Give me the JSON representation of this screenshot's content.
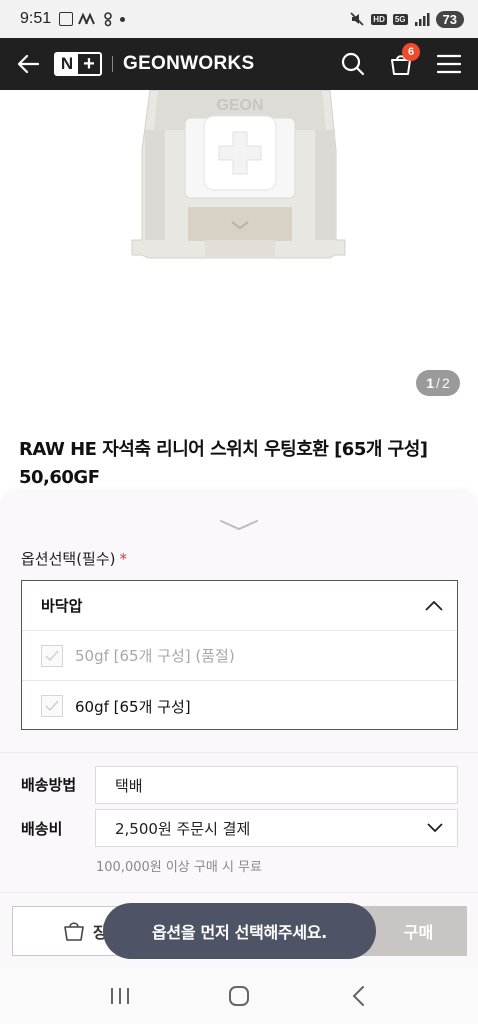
{
  "status_bar": {
    "time": "9:51",
    "left_icons": [
      "screenshot-icon",
      "app-notification-icon",
      "settings-notification-icon",
      "dot-icon"
    ],
    "right_icons": [
      "mute-icon",
      "hd-voice-icon",
      "5g-icon",
      "signal-icon"
    ],
    "hd_label": "HD",
    "fiveg_label": "5G",
    "battery": "73"
  },
  "header": {
    "logo_n": "N",
    "logo_plus": "+",
    "store_name": "GEONWORKS",
    "cart_count": "6",
    "bg_color": "#202020",
    "badge_color": "#f04a2c"
  },
  "gallery": {
    "current": "1",
    "separator": "/",
    "total": "2",
    "switch_brand": "GEON"
  },
  "product": {
    "title": "RAW HE 자석축 리니어 스위치 우팅호환 [65개 구성] 50,60GF"
  },
  "options": {
    "label": "옵션선택(필수)",
    "required_mark": "*",
    "group_name": "바닥압",
    "items": [
      {
        "label": "50gf [65개 구성] (품절)",
        "disabled": true
      },
      {
        "label": "60gf [65개 구성]",
        "disabled": false
      }
    ]
  },
  "shipping": {
    "method_label": "배송방법",
    "method_value": "택배",
    "fee_label": "배송비",
    "fee_value": "2,500원 주문시 결제",
    "free_note": "100,000원 이상 구매 시 무료"
  },
  "actions": {
    "cart_label": "장바구니",
    "buy_label": "구매",
    "buy_disabled_color": "#c9c5c5"
  },
  "toast": {
    "message": "옵션을 먼저 선택해주세요."
  },
  "nav": {
    "buttons": [
      "recent-apps-icon",
      "home-icon",
      "back-icon"
    ]
  }
}
